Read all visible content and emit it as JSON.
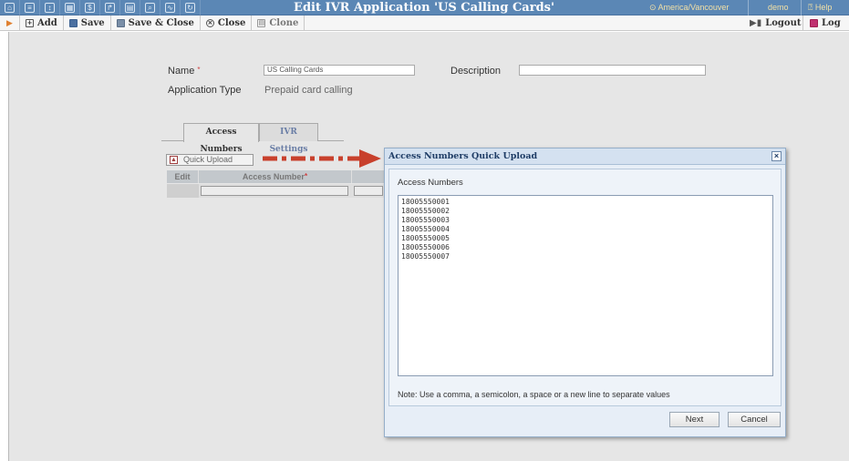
{
  "window": {
    "title": "Edit IVR Application 'US Calling Cards'",
    "timezone": "America/Vancouver",
    "user": "demo",
    "help_label": "Help"
  },
  "topbar_icons": [
    "home-icon",
    "list-icon",
    "pin-icon",
    "grid-icon",
    "dollar-icon",
    "network-icon",
    "table-icon",
    "search-icon",
    "chart-icon",
    "refresh-icon"
  ],
  "toolbar": {
    "add_label": "Add",
    "save_label": "Save",
    "save_close_label": "Save & Close",
    "close_label": "Close",
    "clone_label": "Clone",
    "logout_label": "Logout",
    "log_label": "Log"
  },
  "form": {
    "name_label": "Name",
    "name_value": "US Calling Cards",
    "description_label": "Description",
    "description_value": "",
    "app_type_label": "Application Type",
    "app_type_value": "Prepaid card calling"
  },
  "tabs": [
    {
      "label": "Access Numbers",
      "active": true
    },
    {
      "label": "IVR Settings",
      "active": false
    }
  ],
  "access_numbers": {
    "quick_upload_label": "Quick Upload",
    "columns": [
      "Edit",
      "Access Number"
    ]
  },
  "dialog": {
    "title": "Access Numbers Quick Upload",
    "field_label": "Access Numbers",
    "numbers": [
      "18005550001",
      "18005550002",
      "18005550003",
      "18005550004",
      "18005550005",
      "18005550006",
      "18005550007"
    ],
    "note": "Note: Use a comma, a semicolon, a space or a new line to separate values",
    "next_label": "Next",
    "cancel_label": "Cancel",
    "close_glyph": "×"
  },
  "colors": {
    "topbar": "#5b87b5",
    "accent_orange": "#f2e0a6",
    "arrow_red": "#c8402c",
    "dialog_bg": "#e7eef7"
  }
}
